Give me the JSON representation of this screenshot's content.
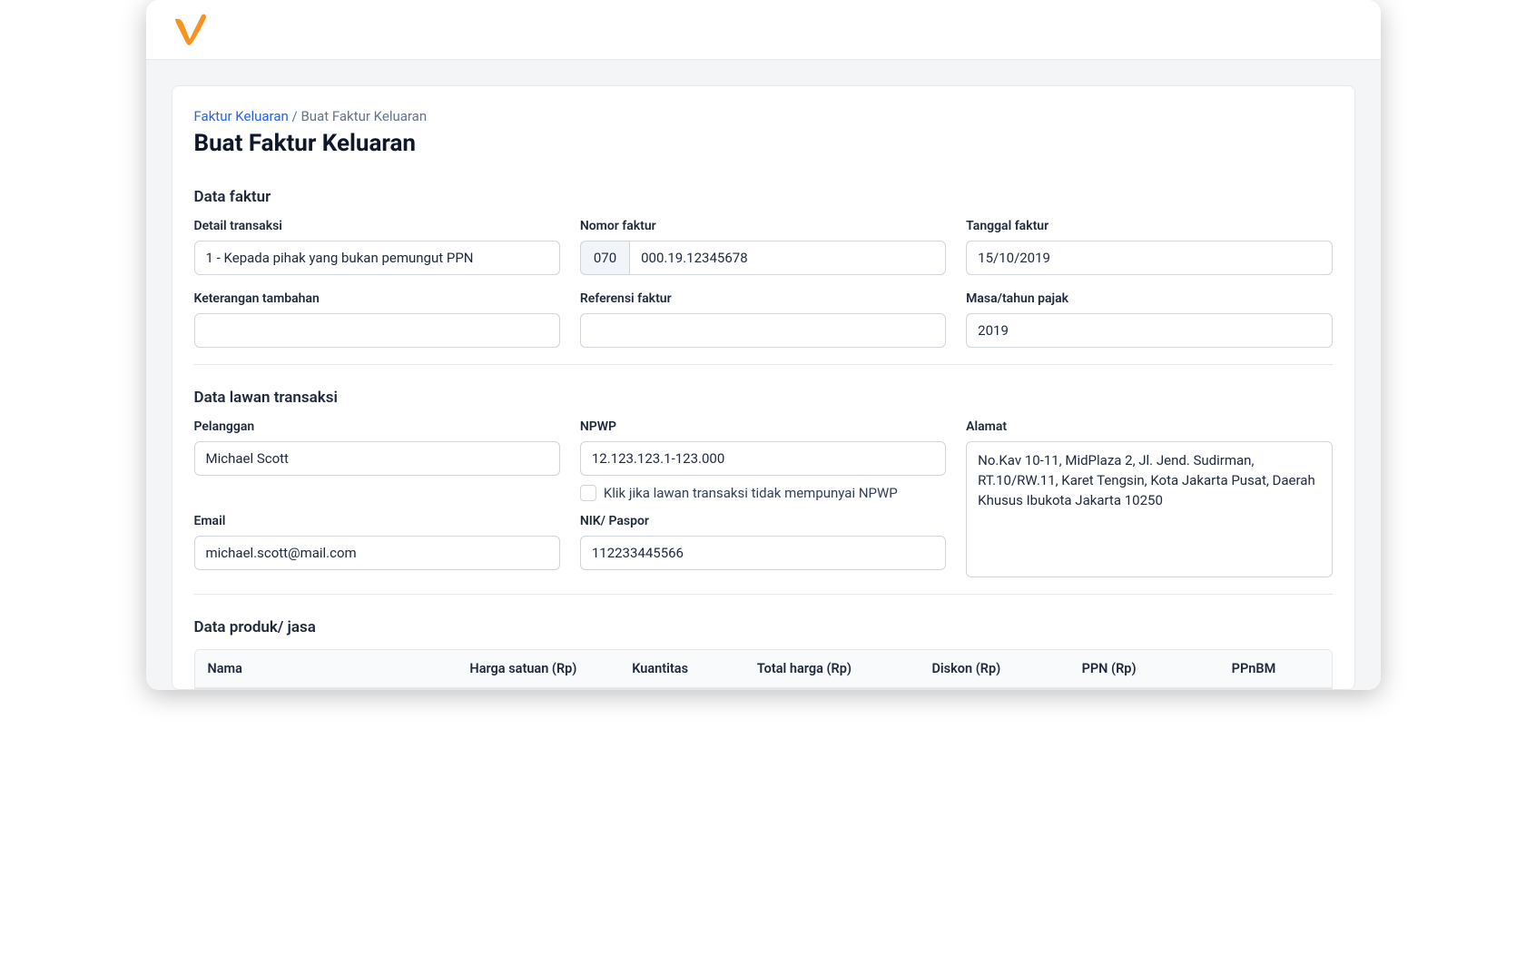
{
  "breadcrumb": {
    "root": "Faktur Keluaran",
    "sep": "/",
    "current": "Buat Faktur Keluaran"
  },
  "page_title": "Buat Faktur Keluaran",
  "sections": {
    "faktur": {
      "title": "Data faktur",
      "detail_transaksi": {
        "label": "Detail transaksi",
        "value": "1 - Kepada pihak yang bukan pemungut PPN"
      },
      "nomor_faktur": {
        "label": "Nomor faktur",
        "prefix": "070",
        "value": "000.19.12345678"
      },
      "tanggal_faktur": {
        "label": "Tanggal faktur",
        "value": "15/10/2019"
      },
      "keterangan_tambahan": {
        "label": "Keterangan tambahan",
        "value": ""
      },
      "referensi_faktur": {
        "label": "Referensi faktur",
        "value": ""
      },
      "masa_tahun_pajak": {
        "label": "Masa/tahun pajak",
        "value": "2019"
      }
    },
    "lawan": {
      "title": "Data lawan transaksi",
      "pelanggan": {
        "label": "Pelanggan",
        "value": "Michael Scott"
      },
      "npwp": {
        "label": "NPWP",
        "value": "12.123.123.1-123.000",
        "checkbox_label": "Klik jika lawan transaksi tidak mempunyai NPWP"
      },
      "alamat": {
        "label": "Alamat",
        "value": "No.Kav 10-11, MidPlaza 2, Jl. Jend. Sudirman, RT.10/RW.11, Karet Tengsin, Kota Jakarta Pusat, Daerah Khusus Ibukota Jakarta 10250"
      },
      "email": {
        "label": "Email",
        "value": "michael.scott@mail.com"
      },
      "nik": {
        "label": "NIK/ Paspor",
        "value": "112233445566"
      }
    },
    "produk": {
      "title": "Data produk/ jasa",
      "columns": {
        "nama": "Nama",
        "harga": "Harga satuan (Rp)",
        "kuantitas": "Kuantitas",
        "total": "Total harga (Rp)",
        "diskon": "Diskon (Rp)",
        "ppn": "PPN (Rp)",
        "ppnbm": "PPnBM"
      }
    }
  }
}
